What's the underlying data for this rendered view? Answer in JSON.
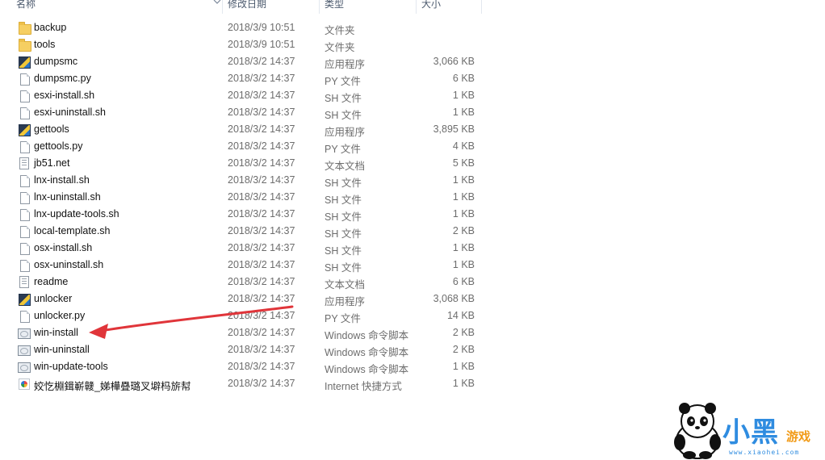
{
  "columns": {
    "name": "名称",
    "date": "修改日期",
    "type": "类型",
    "size": "大小"
  },
  "files": [
    {
      "name": "backup",
      "date": "2018/3/9 10:51",
      "type": "文件夹",
      "size": "",
      "icon": "folder-icon"
    },
    {
      "name": "tools",
      "date": "2018/3/9 10:51",
      "type": "文件夹",
      "size": "",
      "icon": "folder-icon"
    },
    {
      "name": "dumpsmc",
      "date": "2018/3/2 14:37",
      "type": "应用程序",
      "size": "3,066 KB",
      "icon": "application-icon"
    },
    {
      "name": "dumpsmc.py",
      "date": "2018/3/2 14:37",
      "type": "PY 文件",
      "size": "6 KB",
      "icon": "file-icon"
    },
    {
      "name": "esxi-install.sh",
      "date": "2018/3/2 14:37",
      "type": "SH 文件",
      "size": "1 KB",
      "icon": "file-icon"
    },
    {
      "name": "esxi-uninstall.sh",
      "date": "2018/3/2 14:37",
      "type": "SH 文件",
      "size": "1 KB",
      "icon": "file-icon"
    },
    {
      "name": "gettools",
      "date": "2018/3/2 14:37",
      "type": "应用程序",
      "size": "3,895 KB",
      "icon": "application-icon"
    },
    {
      "name": "gettools.py",
      "date": "2018/3/2 14:37",
      "type": "PY 文件",
      "size": "4 KB",
      "icon": "file-icon"
    },
    {
      "name": "jb51.net",
      "date": "2018/3/2 14:37",
      "type": "文本文档",
      "size": "5 KB",
      "icon": "text-document-icon"
    },
    {
      "name": "lnx-install.sh",
      "date": "2018/3/2 14:37",
      "type": "SH 文件",
      "size": "1 KB",
      "icon": "file-icon"
    },
    {
      "name": "lnx-uninstall.sh",
      "date": "2018/3/2 14:37",
      "type": "SH 文件",
      "size": "1 KB",
      "icon": "file-icon"
    },
    {
      "name": "lnx-update-tools.sh",
      "date": "2018/3/2 14:37",
      "type": "SH 文件",
      "size": "1 KB",
      "icon": "file-icon"
    },
    {
      "name": "local-template.sh",
      "date": "2018/3/2 14:37",
      "type": "SH 文件",
      "size": "2 KB",
      "icon": "file-icon"
    },
    {
      "name": "osx-install.sh",
      "date": "2018/3/2 14:37",
      "type": "SH 文件",
      "size": "1 KB",
      "icon": "file-icon"
    },
    {
      "name": "osx-uninstall.sh",
      "date": "2018/3/2 14:37",
      "type": "SH 文件",
      "size": "1 KB",
      "icon": "file-icon"
    },
    {
      "name": "readme",
      "date": "2018/3/2 14:37",
      "type": "文本文档",
      "size": "6 KB",
      "icon": "text-document-icon"
    },
    {
      "name": "unlocker",
      "date": "2018/3/2 14:37",
      "type": "应用程序",
      "size": "3,068 KB",
      "icon": "application-icon"
    },
    {
      "name": "unlocker.py",
      "date": "2018/3/2 14:37",
      "type": "PY 文件",
      "size": "14 KB",
      "icon": "file-icon"
    },
    {
      "name": "win-install",
      "date": "2018/3/2 14:37",
      "type": "Windows 命令脚本",
      "size": "2 KB",
      "icon": "command-script-icon"
    },
    {
      "name": "win-uninstall",
      "date": "2018/3/2 14:37",
      "type": "Windows 命令脚本",
      "size": "2 KB",
      "icon": "command-script-icon"
    },
    {
      "name": "win-update-tools",
      "date": "2018/3/2 14:37",
      "type": "Windows 命令脚本",
      "size": "1 KB",
      "icon": "command-script-icon"
    },
    {
      "name": "姣忔棩鍓嶄竷_娣樺疂璐叉壀杩旂幇",
      "date": "2018/3/2 14:37",
      "type": "Internet 快捷方式",
      "size": "1 KB",
      "icon": "internet-shortcut-icon"
    }
  ],
  "annotation": {
    "color": "#e0353a",
    "target": "win-install"
  },
  "watermark": {
    "title": "小黑",
    "subtitle": "游戏",
    "url": "www.xiaohei.com"
  }
}
